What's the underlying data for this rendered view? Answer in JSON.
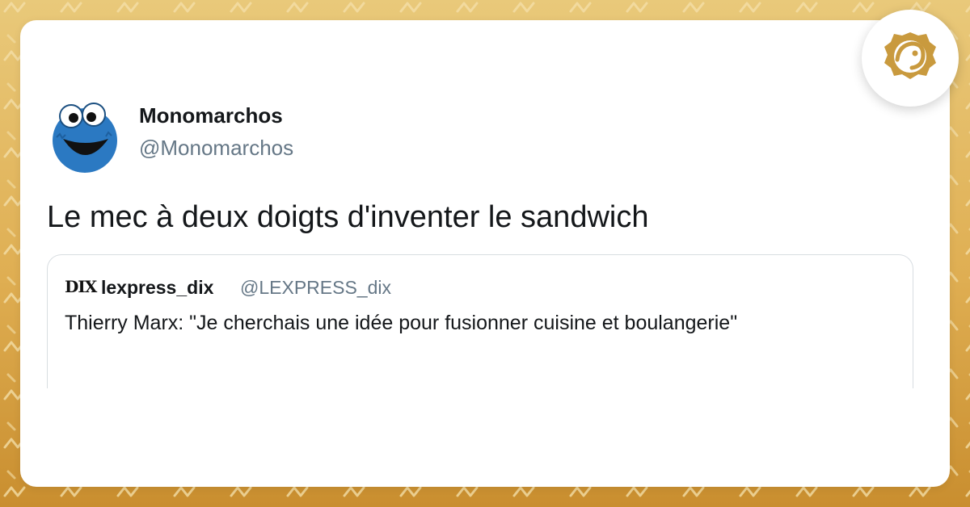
{
  "tweet": {
    "author_name": "Monomarchos",
    "author_handle": "@Monomarchos",
    "text": "Le mec à deux doigts d'inventer le sandwich"
  },
  "quoted_tweet": {
    "logo_text": "DIX",
    "author_name": "lexpress_dix",
    "author_handle": "@LEXPRESS_dix",
    "text": "Thierry Marx: \"Je cherchais une idée pour fusionner cuisine et boulangerie\""
  },
  "icons": {
    "avatar": "cookie-monster-avatar-icon",
    "brand": "brand-logo-icon"
  },
  "colors": {
    "background_top": "#e9c97a",
    "background_bottom": "#c98e2f",
    "card": "#ffffff",
    "text_primary": "#14171a",
    "text_secondary": "#657786",
    "brand_gold": "#c99a3e"
  }
}
